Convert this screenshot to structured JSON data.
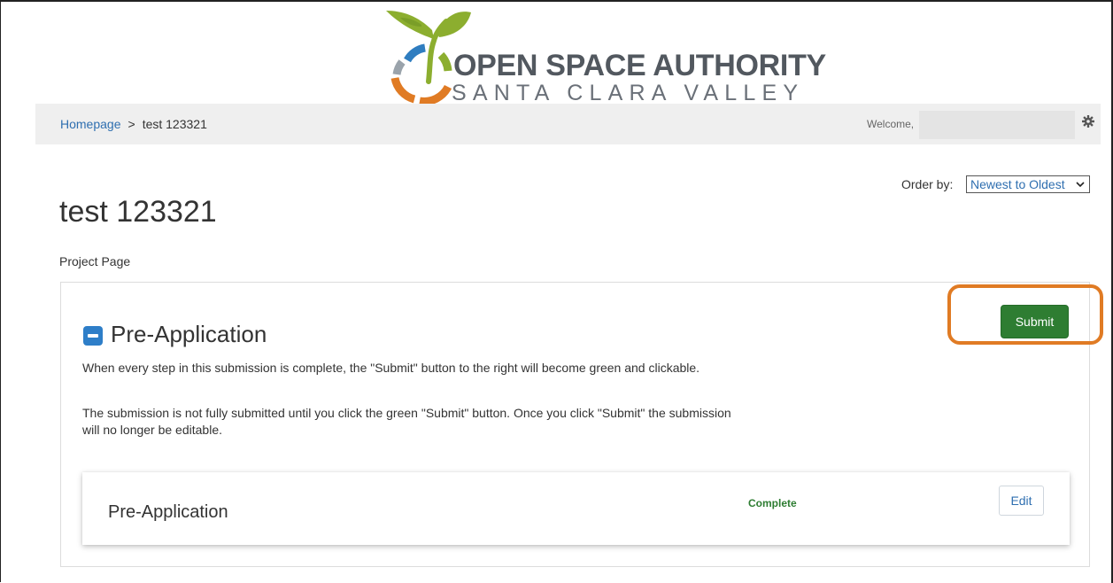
{
  "logo": {
    "title": "OPEN SPACE AUTHORITY",
    "subtitle": "SANTA CLARA VALLEY",
    "colors": {
      "green": "#8cae2f",
      "blue": "#2f7dc0",
      "orange": "#e07b24",
      "gray": "#52585f"
    }
  },
  "nav": {
    "breadcrumb_home": "Homepage",
    "breadcrumb_separator": ">",
    "breadcrumb_current": "test 123321",
    "welcome": "Welcome,",
    "settings_icon": "gear-icon"
  },
  "order": {
    "label": "Order by:",
    "selected": "Newest to Oldest"
  },
  "page": {
    "title": "test 123321",
    "subtitle": "Project Page"
  },
  "submission": {
    "title": "Pre-Application",
    "collapse_icon": "minus-square-icon",
    "description_1": "When every step in this submission is complete, the \"Submit\" button to the right will become green and clickable.",
    "description_2": "The submission is not fully submitted until you click the green \"Submit\" button. Once you click \"Submit\" the submission will no longer be editable.",
    "submit_label": "Submit",
    "submit_color": "#2e7d32",
    "highlight_color": "#e07b24"
  },
  "steps": [
    {
      "title": "Pre-Application",
      "status": "Complete",
      "status_color": "#2e7d32",
      "action_label": "Edit"
    }
  ]
}
